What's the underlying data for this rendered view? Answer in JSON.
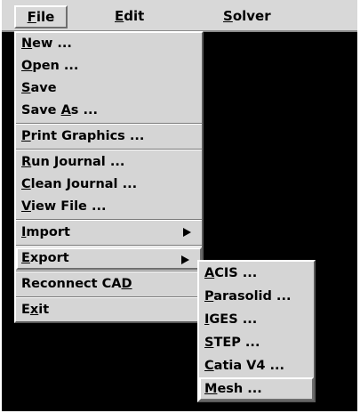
{
  "menubar": {
    "items": [
      {
        "label": "File",
        "ul": "F",
        "rest": "ile"
      },
      {
        "label": "Edit",
        "ul": "E",
        "rest": "dit"
      },
      {
        "label": "Solver",
        "ul": "S",
        "rest": "olver"
      }
    ]
  },
  "file_menu": {
    "items": [
      {
        "pre": "",
        "ul": "N",
        "rest": "ew ..."
      },
      {
        "pre": "",
        "ul": "O",
        "rest": "pen ..."
      },
      {
        "pre": "",
        "ul": "S",
        "rest": "ave"
      },
      {
        "pre": "Save ",
        "ul": "A",
        "rest": "s ..."
      },
      {
        "pre": "",
        "ul": "P",
        "rest": "rint Graphics ..."
      },
      {
        "pre": "",
        "ul": "R",
        "rest": "un Journal ..."
      },
      {
        "pre": "",
        "ul": "C",
        "rest": "lean Journal ..."
      },
      {
        "pre": "",
        "ul": "V",
        "rest": "iew File ..."
      },
      {
        "pre": "",
        "ul": "I",
        "rest": "mport"
      },
      {
        "pre": "",
        "ul": "E",
        "rest": "xport"
      },
      {
        "pre": "Reconnect CA",
        "ul": "D",
        "rest": ""
      },
      {
        "pre": "E",
        "ul": "x",
        "rest": "it"
      }
    ]
  },
  "export_submenu": {
    "items": [
      {
        "ul": "A",
        "rest": "CIS ..."
      },
      {
        "ul": "P",
        "rest": "arasolid ..."
      },
      {
        "ul": "I",
        "rest": "GES ..."
      },
      {
        "ul": "S",
        "rest": "TEP ..."
      },
      {
        "ul": "C",
        "rest": "atia V4 ..."
      },
      {
        "ul": "M",
        "rest": "esh ..."
      }
    ]
  }
}
